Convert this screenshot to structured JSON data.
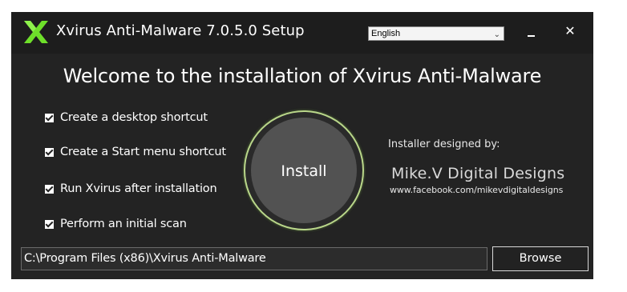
{
  "window": {
    "title": "Xvirus Anti-Malware 7.0.5.0 Setup",
    "logo_icon": "xvirus-x-logo-icon",
    "accent_color": "#6ee02a"
  },
  "language": {
    "selected": "English"
  },
  "controls": {
    "minimize": "minimize-icon",
    "close_glyph": "✕"
  },
  "heading": "Welcome to the installation of Xvirus Anti-Malware",
  "options": [
    {
      "label": "Create a desktop shortcut",
      "checked": true
    },
    {
      "label": "Create a Start menu shortcut",
      "checked": true
    },
    {
      "label": "Run Xvirus after installation",
      "checked": true
    },
    {
      "label": "Perform an initial scan",
      "checked": true
    }
  ],
  "install_label": "Install",
  "credits": {
    "designed_by": "Installer designed by:",
    "brand": "Mike.V Digital Designs",
    "url": "www.facebook.com/mikevdigitaldesigns"
  },
  "install_path": "C:\\Program Files (x86)\\Xvirus Anti-Malware",
  "browse_label": "Browse"
}
